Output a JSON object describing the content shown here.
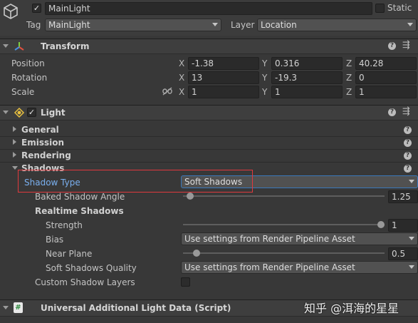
{
  "object": {
    "name": "MainLight",
    "active": true,
    "static_label": "Static",
    "static_checked": false,
    "tag_label": "Tag",
    "tag_value": "MainLight",
    "layer_label": "Layer",
    "layer_value": "Location"
  },
  "transform": {
    "title": "Transform",
    "position_label": "Position",
    "rotation_label": "Rotation",
    "scale_label": "Scale",
    "axis_x": "X",
    "axis_y": "Y",
    "axis_z": "Z",
    "position": {
      "x": "-1.38",
      "y": "0.316",
      "z": "40.28"
    },
    "rotation": {
      "x": "13",
      "y": "-19.3",
      "z": "0"
    },
    "scale": {
      "x": "1",
      "y": "1",
      "z": "1"
    }
  },
  "light": {
    "title": "Light",
    "enabled": true,
    "sections": {
      "general": "General",
      "emission": "Emission",
      "rendering": "Rendering",
      "shadows": "Shadows"
    },
    "shadow_type_label": "Shadow Type",
    "shadow_type_value": "Soft Shadows",
    "baked_shadow_angle_label": "Baked Shadow Angle",
    "baked_shadow_angle_value": "1.25",
    "baked_shadow_angle_fraction": 0.02,
    "realtime_shadows_label": "Realtime Shadows",
    "strength_label": "Strength",
    "strength_value": "1",
    "strength_fraction": 1.0,
    "bias_label": "Bias",
    "bias_value": "Use settings from Render Pipeline Asset",
    "near_plane_label": "Near Plane",
    "near_plane_value": "0.5",
    "near_plane_fraction": 0.05,
    "soft_shadows_quality_label": "Soft Shadows Quality",
    "soft_shadows_quality_value": "Use settings from Render Pipeline Asset",
    "custom_shadow_layers_label": "Custom Shadow Layers",
    "custom_shadow_layers_checked": false
  },
  "additional": {
    "title": "Universal Additional Light Data (Script)"
  },
  "watermark": "知乎 @洱海的星星",
  "colors": {
    "highlight_box": "#e0393e",
    "shadow_type_label": "#7ab0f0",
    "shadow_type_field_border": "#3a79bb"
  }
}
